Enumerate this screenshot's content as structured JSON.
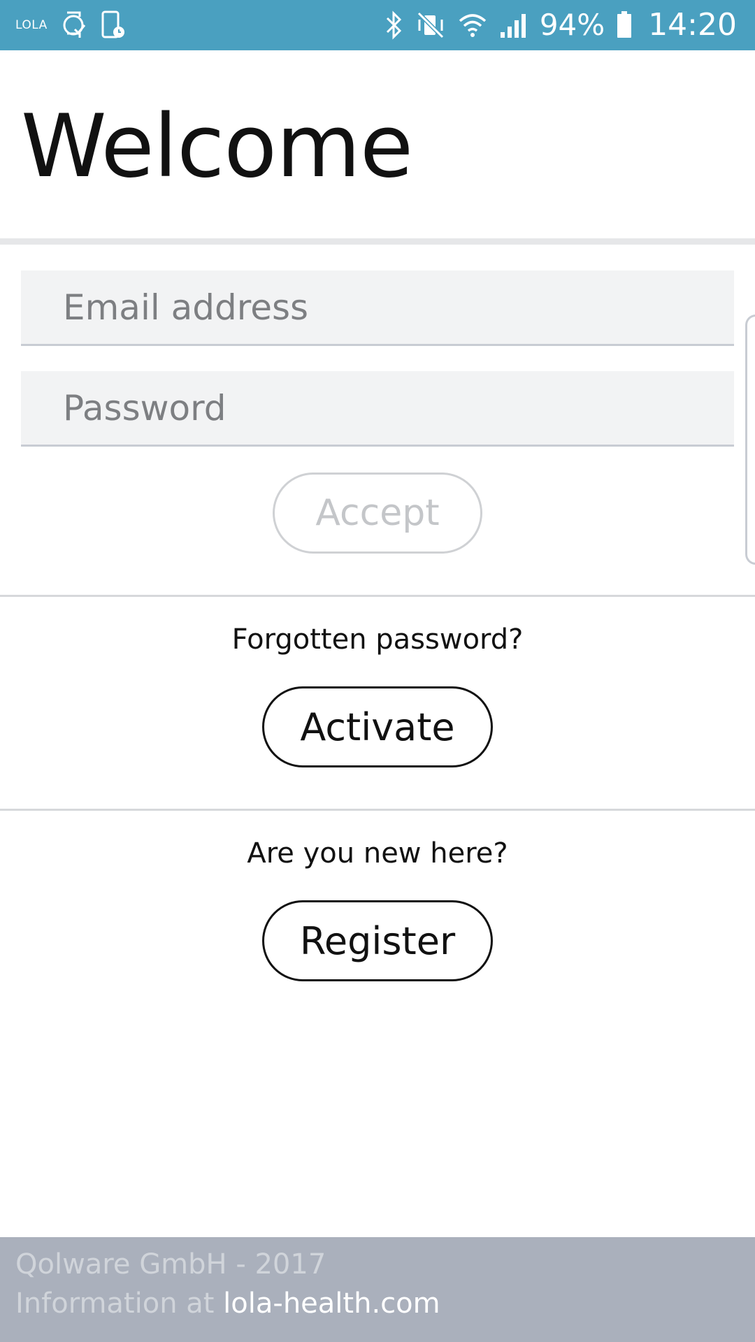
{
  "status_bar": {
    "app_label": "LOLA",
    "battery": "94%",
    "time": "14:20",
    "icons": [
      "lola-notification-icon",
      "watch-check-icon",
      "phone-clock-icon",
      "bluetooth-icon",
      "mute-vibrate-icon",
      "wifi-icon",
      "signal-icon",
      "battery-icon"
    ],
    "background_color": "#4aa0c0"
  },
  "header": {
    "title": "Welcome"
  },
  "login_form": {
    "email_placeholder": "Email address",
    "password_placeholder": "Password",
    "accept_label": "Accept"
  },
  "forgot_section": {
    "prompt": "Forgotten password?",
    "button_label": "Activate"
  },
  "register_section": {
    "prompt": "Are you new here?",
    "button_label": "Register"
  },
  "footer": {
    "company": "Qolware GmbH - 2017",
    "info_prefix": "Information at ",
    "link": "lola-health.com",
    "background_color": "#aab0bc"
  }
}
